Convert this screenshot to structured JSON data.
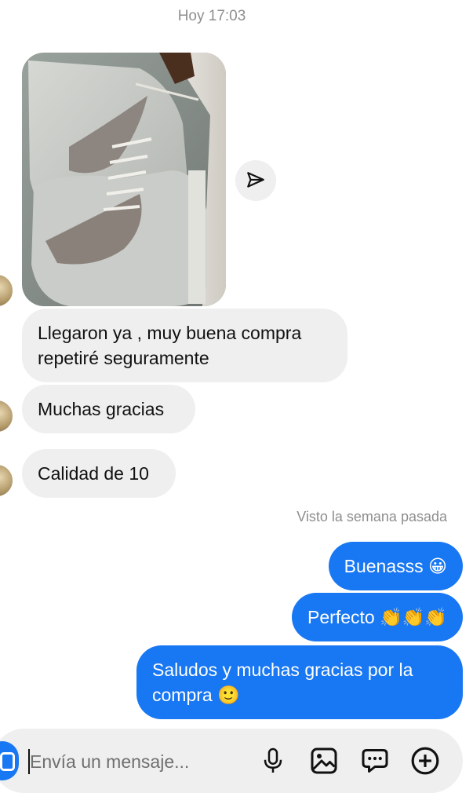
{
  "header": {
    "timestamp": "Hoy 17:03"
  },
  "messages_in": [
    {
      "text": "Llegaron ya , muy buena compra repetiré seguramente"
    },
    {
      "text": "Muchas gracias"
    },
    {
      "text": "Calidad de 10"
    }
  ],
  "seen_status": "Visto la semana pasada",
  "messages_out": [
    {
      "text": "Buenasss 😀"
    },
    {
      "text": "Perfecto 👏👏👏"
    },
    {
      "text": "Saludos y muchas gracias por la compra 🙂"
    }
  ],
  "composer": {
    "placeholder": "Envía un mensaje..."
  },
  "icons": {
    "share": "send-icon",
    "camera": "camera-icon",
    "mic": "microphone-icon",
    "gallery": "image-icon",
    "sticker": "chat-bubble-icon",
    "more": "plus-circle-icon"
  },
  "colors": {
    "accent": "#1877f2",
    "incoming_bubble": "#efefef",
    "meta_text": "#8e8e8e"
  }
}
